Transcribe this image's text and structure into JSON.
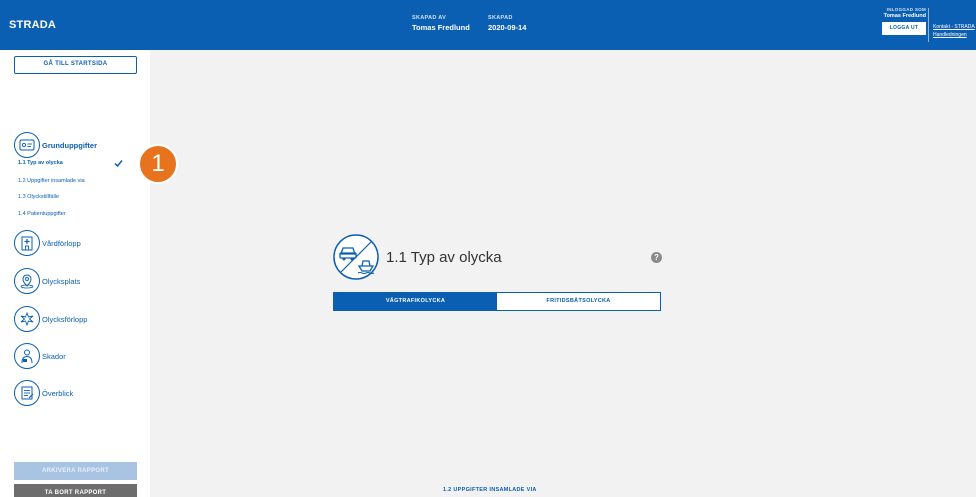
{
  "header": {
    "brand": "STRADA",
    "created_by_label": "SKAPAD AV",
    "created_by": "Tomas Fredlund",
    "created_label": "SKAPAD",
    "created": "2020-09-14",
    "logged_in_label": "INLOGGAD SOM",
    "logged_in_user": "Tomas Fredlund",
    "logout_label": "LOGGA UT",
    "links": [
      "Kontakt - STRADA",
      "Handledningen"
    ]
  },
  "sidebar": {
    "home_button": "GÅ TILL STARTSIDA",
    "sections": [
      {
        "label": "Grunduppgifter",
        "icon": "id-card-icon"
      },
      {
        "label": "Vårdförlopp",
        "icon": "hospital-icon"
      },
      {
        "label": "Olycksplats",
        "icon": "location-icon"
      },
      {
        "label": "Olycksförlopp",
        "icon": "collision-icon"
      },
      {
        "label": "Skador",
        "icon": "injury-icon"
      },
      {
        "label": "Överblick",
        "icon": "overview-icon"
      }
    ],
    "sub_items": [
      "1.1 Typ av olycka",
      "1.2 Uppgifter insamlade via",
      "1.3 Olyckstillfälle",
      "1.4 Patientuppgifter"
    ],
    "archive_button": "ARKIVERA RAPPORT",
    "delete_button": "TA BORT RAPPORT"
  },
  "badge": "1",
  "main": {
    "title": "1.1 Typ av olycka",
    "help": "?",
    "tabs": [
      "VÄGTRAFIKOLYCKA",
      "FRITIDSBÅTSOLYCKA"
    ],
    "next_link": "1.2 UPPGIFTER INSAMLADE VIA"
  },
  "colors": {
    "primary": "#0b5fb3",
    "badge": "#e8731e",
    "background": "#f2f2f2"
  }
}
